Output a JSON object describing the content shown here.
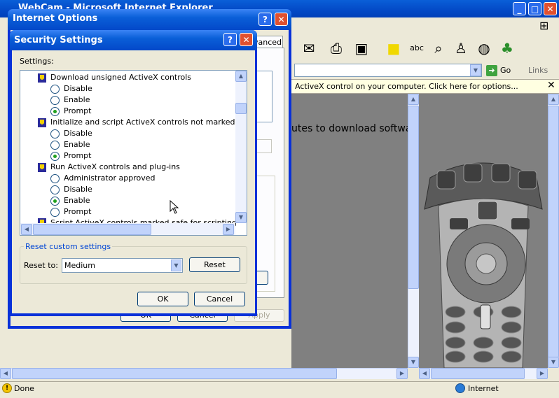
{
  "ie_window": {
    "title": "WebCam - Microsoft Internet Explorer",
    "address_go": "Go",
    "links_label": "Links",
    "infobar_text": "ActiveX control on your computer. Click here for options...",
    "content_text": "utes to download softwa",
    "status_text": "Done",
    "zone_text": "Internet"
  },
  "internet_options": {
    "title": "Internet Options",
    "advanced_tab_fragment": "vanced",
    "ok_label": "OK",
    "cancel_label": "Cancel",
    "apply_label": "Apply"
  },
  "security_settings": {
    "title": "Security Settings",
    "settings_label": "Settings:",
    "items": [
      {
        "label": "Download unsigned ActiveX controls",
        "options": [
          "Disable",
          "Enable",
          "Prompt"
        ],
        "selected": "Prompt"
      },
      {
        "label": "Initialize and script ActiveX controls not marked as safe",
        "options": [
          "Disable",
          "Enable",
          "Prompt"
        ],
        "selected": "Prompt"
      },
      {
        "label": "Run ActiveX controls and plug-ins",
        "options": [
          "Administrator approved",
          "Disable",
          "Enable",
          "Prompt"
        ],
        "selected": "Enable"
      },
      {
        "label": "Script ActiveX controls marked safe for scripting"
      }
    ],
    "reset_group_label": "Reset custom settings",
    "reset_to_label": "Reset to:",
    "reset_to_value": "Medium",
    "reset_button": "Reset",
    "ok_label": "OK",
    "cancel_label": "Cancel"
  },
  "colors": {
    "xp_title_blue": "#0a5fd8",
    "selected_radio": "#21a121",
    "infobar_bg": "#ffffe1"
  }
}
